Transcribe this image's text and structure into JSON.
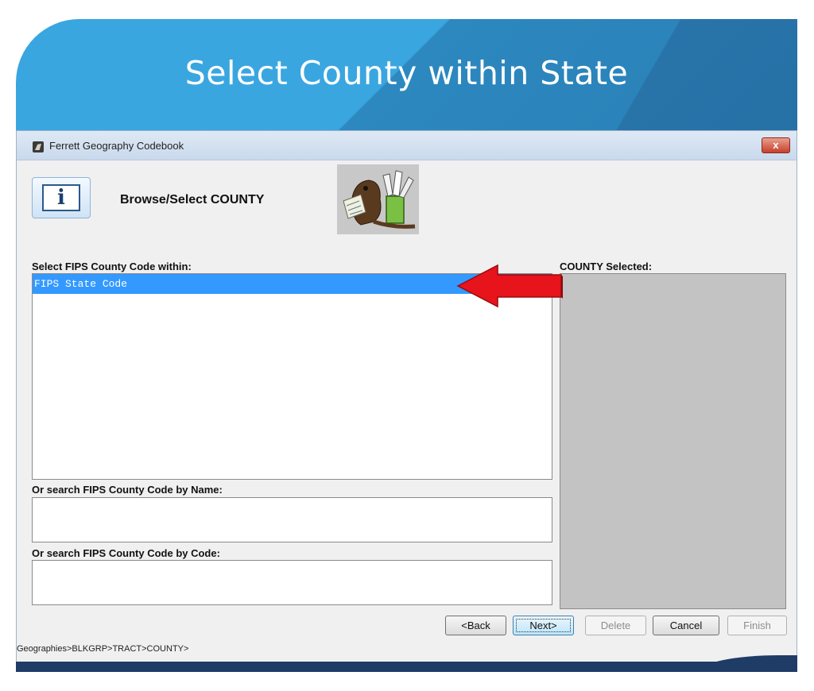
{
  "slide": {
    "title": "Select County within State"
  },
  "window": {
    "title": "Ferrett Geography Codebook",
    "close_label": "x",
    "info_label": "i",
    "heading": "Browse/Select COUNTY"
  },
  "list": {
    "label": "Select FIPS County Code within:",
    "items": [
      "FIPS State Code"
    ]
  },
  "search_by_name": {
    "label": "Or search FIPS County Code by Name:",
    "value": ""
  },
  "search_by_code": {
    "label": "Or search FIPS County Code by Code:",
    "value": ""
  },
  "selected": {
    "label": "COUNTY Selected:"
  },
  "buttons": {
    "back": "<Back",
    "next": "Next>",
    "delete": "Delete",
    "cancel": "Cancel",
    "finish": "Finish"
  },
  "breadcrumb": "Geographies>BLKGRP>TRACT>COUNTY>",
  "colors": {
    "banner": "#3aa6e0",
    "selection": "#3399ff",
    "arrow": "#e8141b"
  },
  "icons": {
    "app": "ferrett-icon",
    "info": "info-icon",
    "mascot": "ferret-mascot-image",
    "pointer": "red-arrow-icon"
  }
}
